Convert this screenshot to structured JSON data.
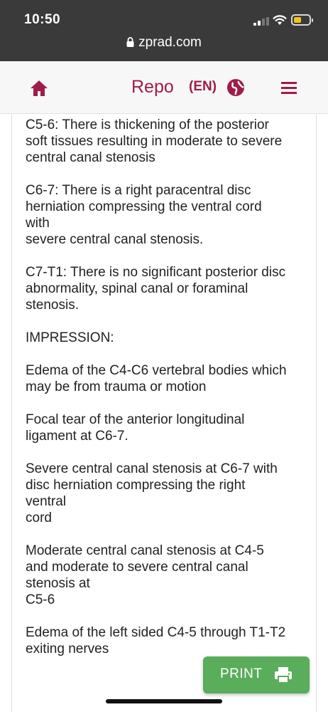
{
  "status_bar": {
    "time": "10:50",
    "signal_icon": "cell-signal-icon",
    "wifi_icon": "wifi-icon",
    "battery_icon": "battery-icon",
    "battery_level": 0.35,
    "battery_color": "#f4c21a"
  },
  "browser": {
    "url": "zprad.com",
    "lock_icon": "lock-icon"
  },
  "header": {
    "home_icon": "home-icon",
    "title": "Repo",
    "language": "(EN)",
    "globe_icon": "globe-icon",
    "menu_icon": "hamburger-menu-icon",
    "accent_color": "#a01c47"
  },
  "report": {
    "paragraphs": [
      [
        "C5-6: There is thickening of the posterior",
        "soft tissues resulting in moderate to severe",
        "central canal stenosis"
      ],
      [
        "C6-7: There is a right paracentral disc",
        "herniation compressing the ventral cord",
        "with",
        "severe central canal stenosis."
      ],
      [
        "C7-T1: There is no significant posterior disc",
        "abnormality, spinal canal or foraminal",
        "stenosis."
      ],
      [
        "IMPRESSION:"
      ],
      [
        "Edema of the C4-C6 vertebral bodies which",
        "may be from trauma or motion"
      ],
      [
        "Focal tear of the anterior longitudinal",
        "ligament at C6-7."
      ],
      [
        "Severe central canal stenosis at C6-7 with",
        "disc herniation compressing the right",
        "ventral",
        "cord"
      ],
      [
        "Moderate central canal stenosis at C4-5",
        "and moderate to severe central canal",
        "stenosis at",
        "C5-6"
      ],
      [
        "Edema of the left sided C4-5 through T1-T2",
        "exiting nerves"
      ]
    ]
  },
  "print_button": {
    "label": "PRINT",
    "icon": "printer-icon",
    "color": "#5aad5a"
  }
}
